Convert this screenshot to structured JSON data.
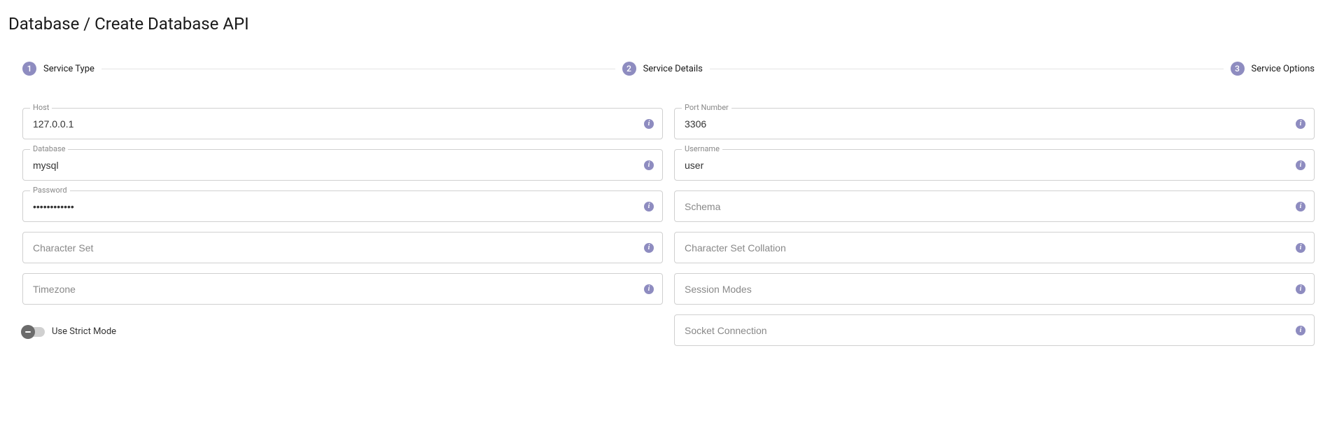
{
  "page": {
    "title": "Database / Create Database API"
  },
  "stepper": {
    "steps": [
      {
        "num": "1",
        "label": "Service Type"
      },
      {
        "num": "2",
        "label": "Service Details"
      },
      {
        "num": "3",
        "label": "Service Options"
      }
    ]
  },
  "fields": {
    "host": {
      "label": "Host",
      "value": "127.0.0.1"
    },
    "port": {
      "label": "Port Number",
      "value": "3306"
    },
    "database": {
      "label": "Database",
      "value": "mysql"
    },
    "username": {
      "label": "Username",
      "value": "user"
    },
    "password": {
      "label": "Password",
      "value": "••••••••••••"
    },
    "schema": {
      "placeholder": "Schema",
      "value": ""
    },
    "charset": {
      "placeholder": "Character Set",
      "value": ""
    },
    "collation": {
      "placeholder": "Character Set Collation",
      "value": ""
    },
    "timezone": {
      "placeholder": "Timezone",
      "value": ""
    },
    "sessionModes": {
      "placeholder": "Session Modes",
      "value": ""
    },
    "socket": {
      "placeholder": "Socket Connection",
      "value": ""
    }
  },
  "toggle": {
    "strictMode": {
      "label": "Use Strict Mode"
    }
  }
}
